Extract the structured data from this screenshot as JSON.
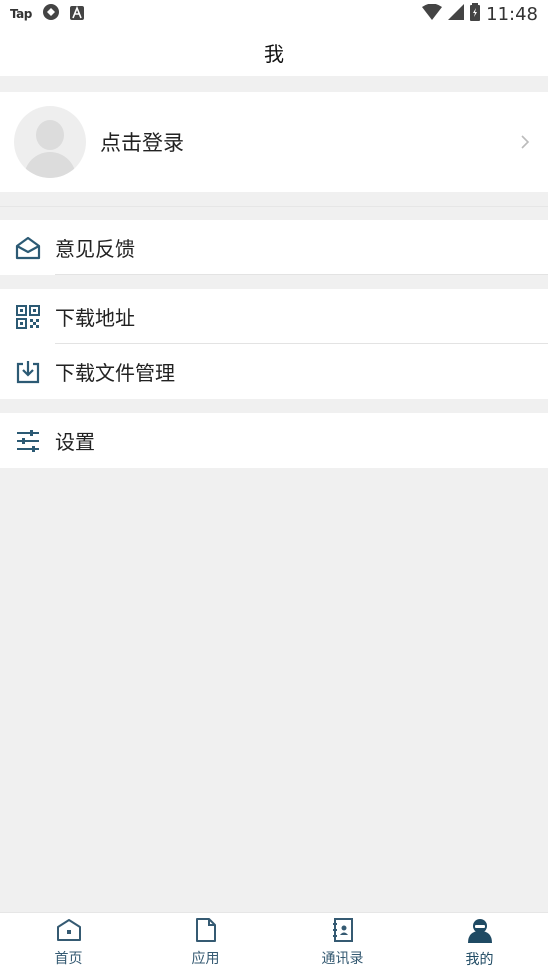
{
  "status_bar": {
    "app_label": "Tap",
    "time": "11:48"
  },
  "header": {
    "title": "我"
  },
  "profile": {
    "login_label": "点击登录"
  },
  "menu_groups": [
    {
      "items": [
        {
          "icon": "mail-open-icon",
          "label": "意见反馈"
        }
      ]
    },
    {
      "items": [
        {
          "icon": "qr-code-icon",
          "label": "下载地址"
        },
        {
          "icon": "download-icon",
          "label": "下载文件管理"
        }
      ]
    },
    {
      "items": [
        {
          "icon": "sliders-icon",
          "label": "设置"
        }
      ]
    }
  ],
  "bottom_nav": {
    "items": [
      {
        "icon": "home-icon",
        "label": "首页"
      },
      {
        "icon": "document-icon",
        "label": "应用"
      },
      {
        "icon": "contacts-icon",
        "label": "通讯录"
      },
      {
        "icon": "user-icon",
        "label": "我的"
      }
    ],
    "active_index": 3
  },
  "colors": {
    "accent": "#1f4a63",
    "icon": "#2c5a74",
    "background": "#f0f0f0"
  }
}
